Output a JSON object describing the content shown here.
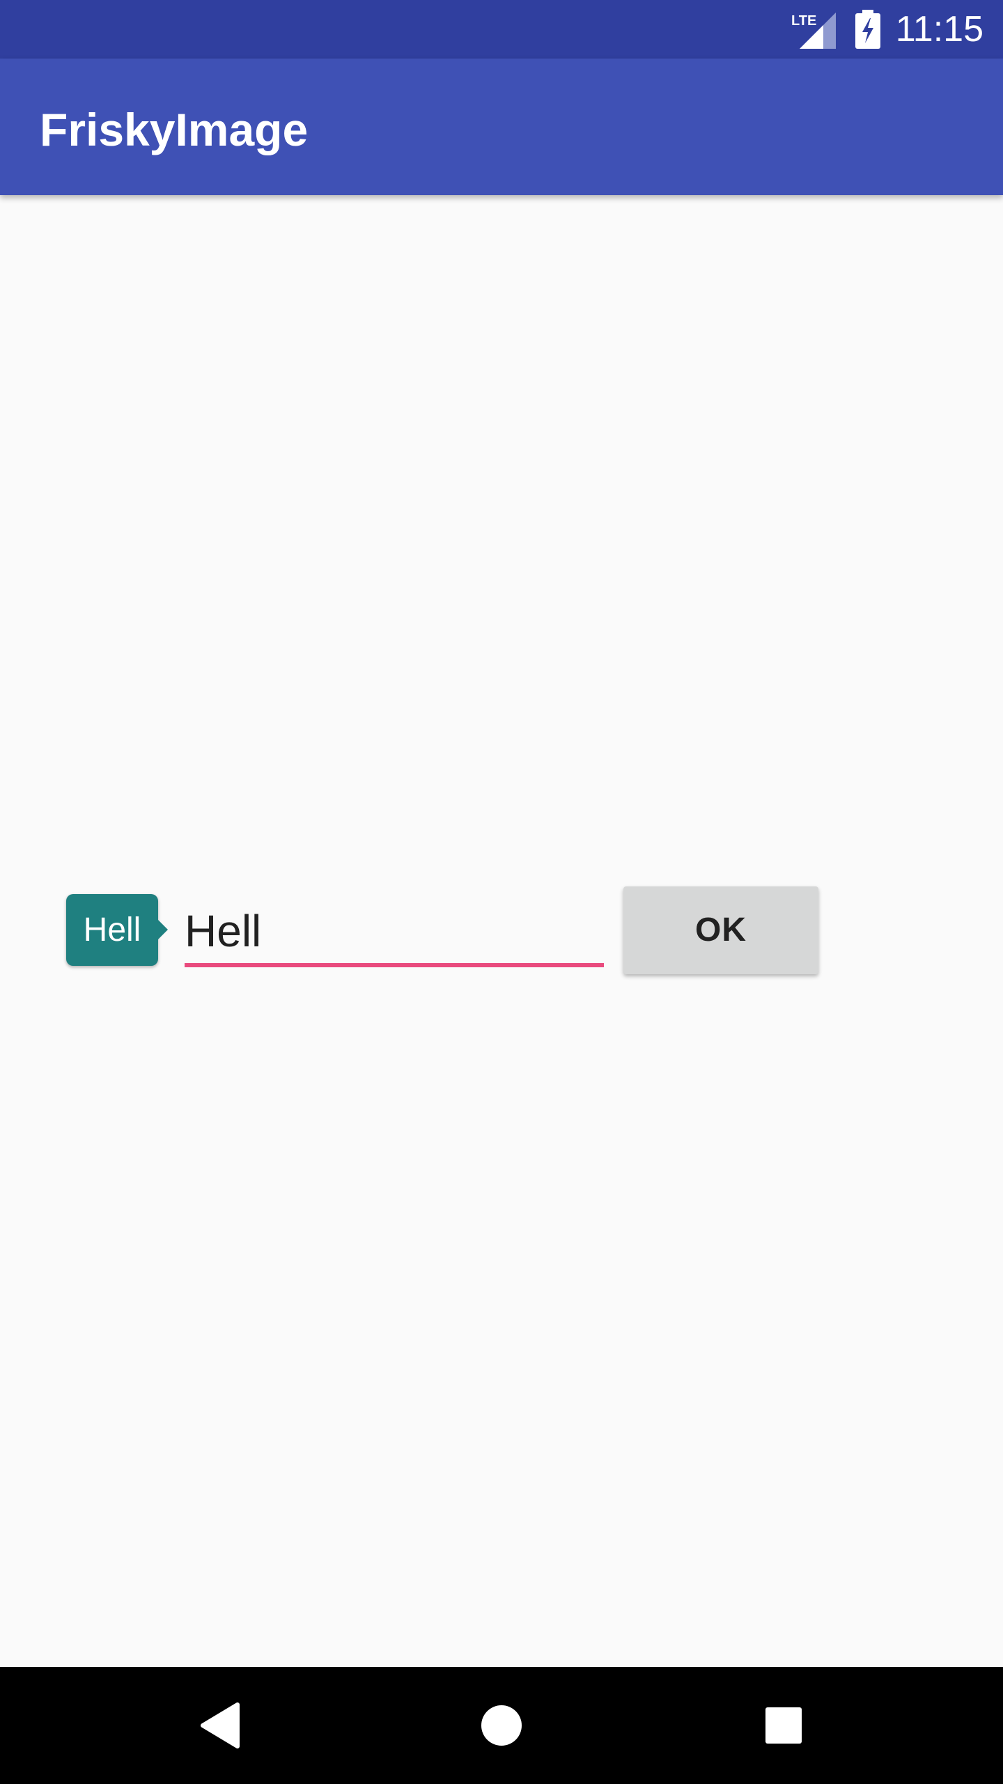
{
  "status_bar": {
    "network_icon": "lte-signal-icon",
    "network_label": "LTE",
    "battery_icon": "battery-charging-icon",
    "time": "11:15"
  },
  "app_bar": {
    "title": "FriskyImage"
  },
  "main": {
    "tooltip_text": "Hell",
    "input_value": "Hell",
    "ok_button_label": "OK"
  },
  "nav_bar": {
    "back_icon": "back-icon",
    "home_icon": "home-icon",
    "recents_icon": "recents-icon"
  },
  "colors": {
    "status_bar": "#303f9f",
    "app_bar": "#3f51b5",
    "accent": "#e94a7d",
    "tooltip": "#1f8080",
    "button": "#d6d7d7"
  }
}
